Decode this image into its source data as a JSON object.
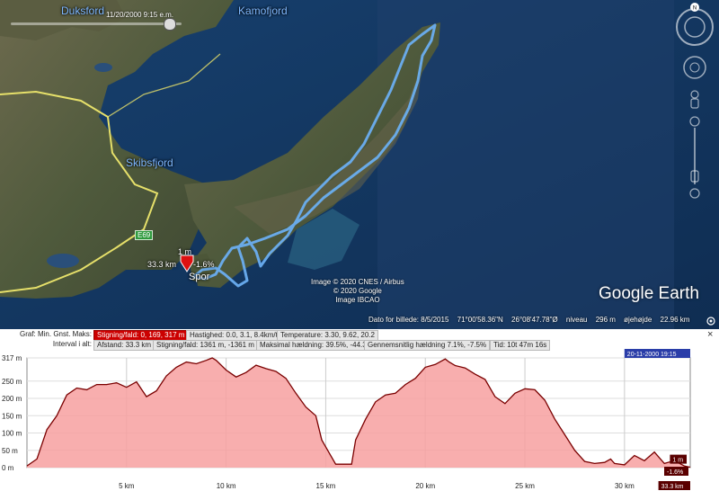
{
  "map": {
    "fjords": [
      "Duksford",
      "Kamofjord",
      "Skibsfjord"
    ],
    "town": "Spor",
    "route_number": "E69",
    "time_slider_stamp": "11/20/2000 9:15 e.m.",
    "marker_labels": {
      "height": "1 m",
      "distance": "33.3 km",
      "grade": "-1.6%"
    },
    "attribution": [
      "Image © 2020 CNES / Airbus",
      "© 2020 Google",
      "Image IBCAO"
    ],
    "brand": "Google Earth",
    "status": {
      "date": "Dato for billede: 8/5/2015",
      "lat": "71°00'58.36\"N",
      "lon": "26°08'47.78\"Ø",
      "level": "niveau",
      "level_value": "296 m",
      "eye": "øjehøjde",
      "eye_value": "22.96 km"
    },
    "nav_icons": [
      "north-compass-icon",
      "look-joystick-icon",
      "move-joystick-icon",
      "street-view-pegman-icon",
      "zoom-slider-icon"
    ],
    "colors": {
      "route": "#6aaef0",
      "road": "#e6e06a",
      "marker": "#dd1111"
    }
  },
  "profile": {
    "row1_label": "Graf: Min. Gnst. Maks:",
    "row1": [
      {
        "text": "Stigning/fald: 0, 169, 317 m",
        "active": true
      },
      {
        "text": "Hastighed: 0.0, 3.1, 8.4km/t",
        "active": false
      },
      {
        "text": "Temperature: 3.30, 9.62, 20.2",
        "active": false
      }
    ],
    "row2_label": "Interval i alt:",
    "row2": [
      {
        "text": "Afstand: 33.3 km",
        "active": false
      },
      {
        "text": "Stigning/fald: 1361 m, -1361 m",
        "active": false
      },
      {
        "text": "Maksimal hældning: 39.5%, -44.3%",
        "active": false
      },
      {
        "text": "Gennemsnitlig hældning 7.1%, -7.5%",
        "active": false
      },
      {
        "text": "Tid: 10t 47m 16s",
        "active": false
      }
    ],
    "close_label": "×",
    "time_tag": "20-11-2000 19:15",
    "cursor_elev_tag": "1 m",
    "cursor_grade_tag": "-1.6%",
    "cursor_dist_tag": "33.3 km"
  },
  "chart_data": {
    "type": "area",
    "title": "",
    "xlabel": "",
    "ylabel": "",
    "xlim": [
      0,
      33.3
    ],
    "ylim": [
      0,
      317
    ],
    "y_ticks": [
      "0 m",
      "50 m",
      "100 m",
      "150 m",
      "200 m",
      "250 m",
      "317 m"
    ],
    "x_ticks": [
      "5 km",
      "10 km",
      "15 km",
      "20 km",
      "25 km",
      "30 km"
    ],
    "x_tick_values": [
      5,
      10,
      15,
      20,
      25,
      30
    ],
    "y_tick_values": [
      0,
      50,
      100,
      150,
      200,
      250,
      317
    ],
    "colors": {
      "line": "#7a0000",
      "fill": "#f7a0a0"
    },
    "series": [
      {
        "x": [
          0,
          0.5,
          1,
          1.5,
          2,
          2.5,
          3,
          3.5,
          4,
          4.5,
          5,
          5.5,
          6,
          6.5,
          7,
          7.5,
          8,
          8.5,
          9,
          9.3,
          9.5,
          10,
          10.5,
          11,
          11.5,
          12,
          12.5,
          13,
          13.5,
          14,
          14.5,
          14.8,
          15,
          15.5,
          16,
          16.3,
          16.5,
          17,
          17.5,
          18,
          18.5,
          19,
          19.5,
          20,
          20.5,
          21,
          21.2,
          21.5,
          22,
          22.5,
          23,
          23.5,
          24,
          24.5,
          25,
          25.5,
          26,
          26.5,
          27,
          27.5,
          28,
          28.5,
          29,
          29.3,
          29.5,
          30,
          30.5,
          31,
          31.5,
          32,
          32.5,
          33,
          33.3
        ],
        "y": [
          5,
          25,
          110,
          150,
          210,
          230,
          225,
          240,
          240,
          245,
          232,
          248,
          205,
          222,
          265,
          290,
          305,
          300,
          310,
          317,
          310,
          282,
          262,
          275,
          296,
          286,
          278,
          258,
          215,
          175,
          150,
          80,
          60,
          10,
          10,
          10,
          80,
          140,
          190,
          210,
          215,
          240,
          258,
          290,
          298,
          314,
          305,
          295,
          288,
          270,
          255,
          205,
          185,
          215,
          228,
          225,
          195,
          140,
          95,
          50,
          18,
          12,
          15,
          25,
          12,
          8,
          35,
          20,
          45,
          12,
          20,
          5,
          1
        ]
      }
    ]
  }
}
